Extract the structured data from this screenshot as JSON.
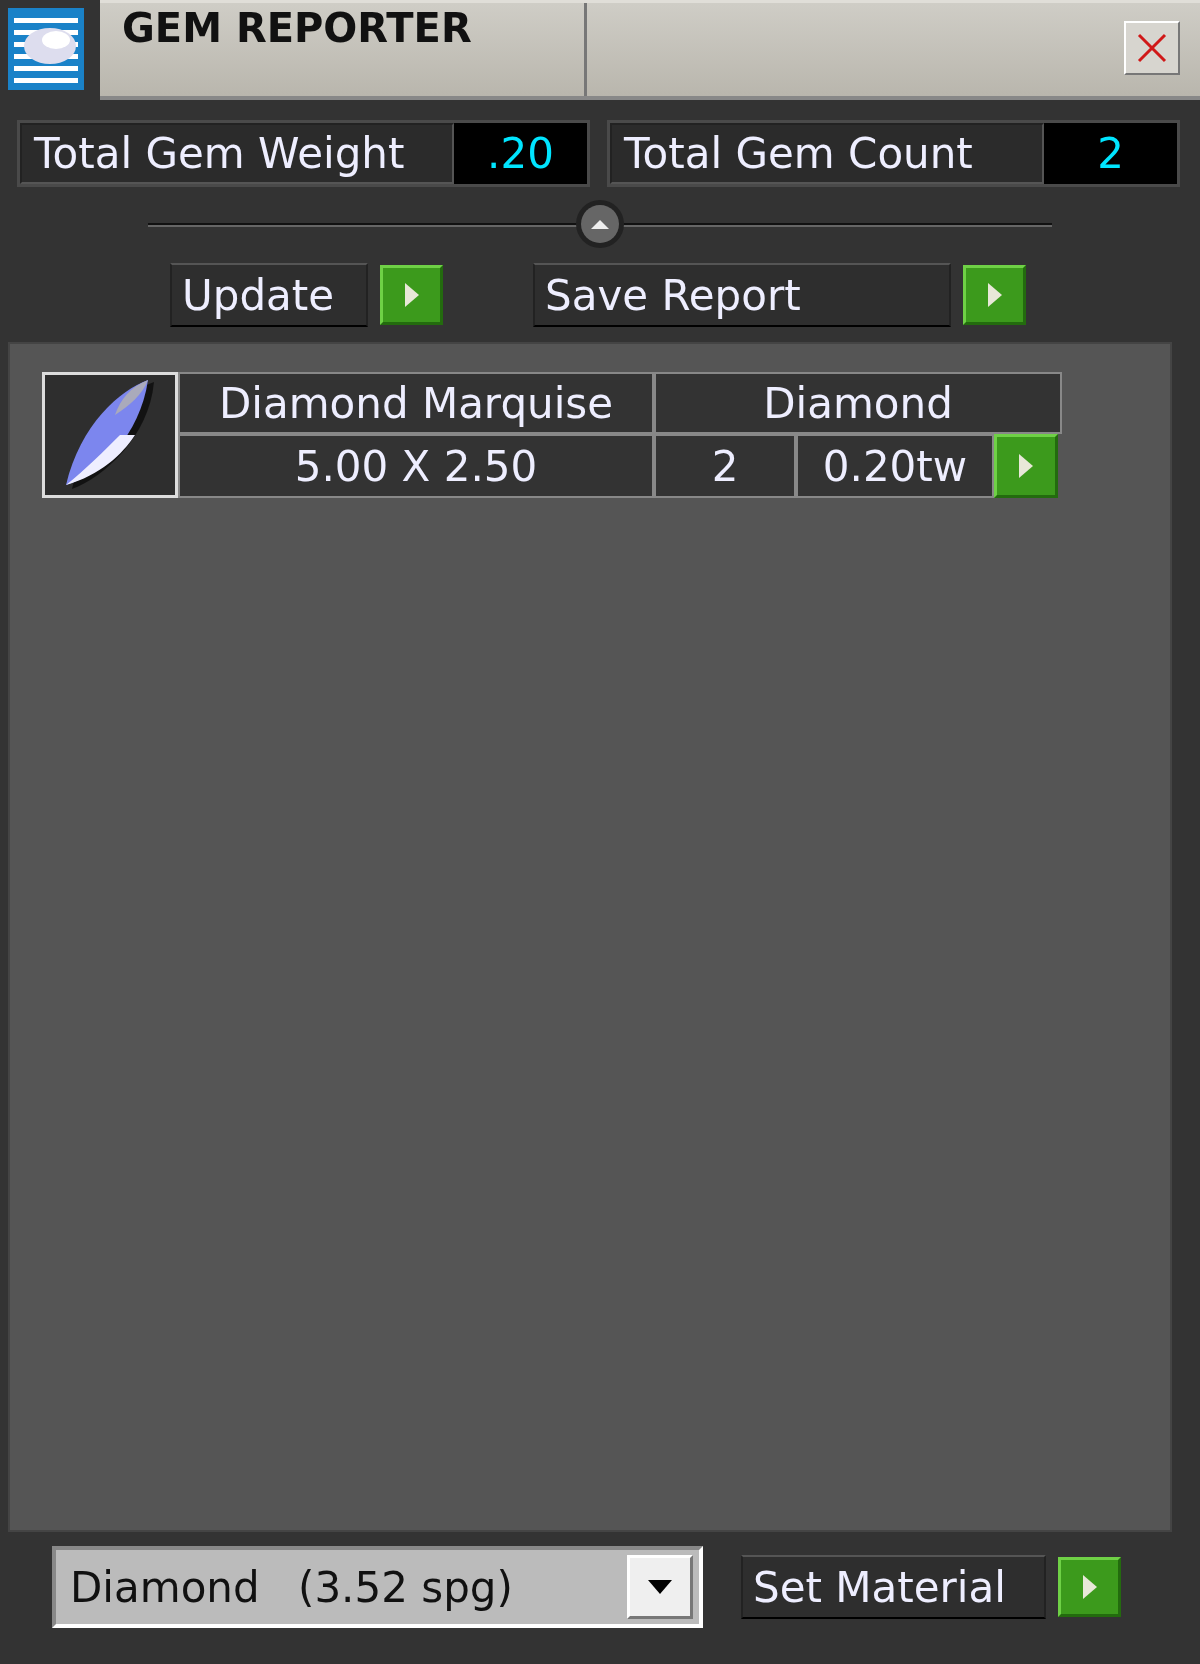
{
  "window": {
    "title": "GEM REPORTER"
  },
  "totals": [
    {
      "label": "Total Gem Weight",
      "value": ".20"
    },
    {
      "label": "Total Gem Count",
      "value": "2"
    }
  ],
  "actions": [
    {
      "label": "Update"
    },
    {
      "label": "Save Report"
    }
  ],
  "gems": [
    {
      "name": "Diamond Marquise",
      "material": "Diamond",
      "size": "5.00 X 2.50",
      "count": "2",
      "weight": "0.20tw"
    }
  ],
  "material_select": {
    "name": "Diamond",
    "density": "(3.52 spg)"
  },
  "set_button": {
    "label": "Set Material"
  }
}
